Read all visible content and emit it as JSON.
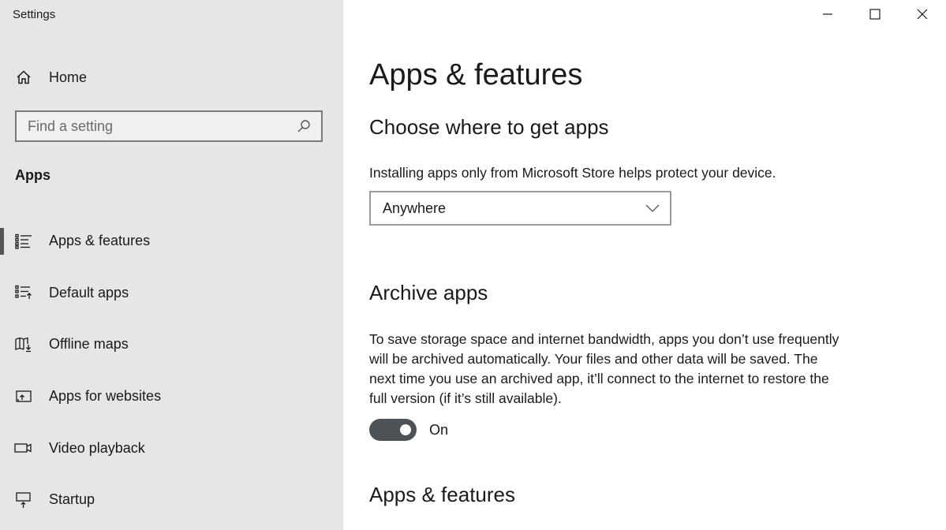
{
  "window": {
    "title": "Settings",
    "controls": {
      "minimize": "minimize-icon",
      "maximize": "maximize-icon",
      "close": "close-icon"
    }
  },
  "sidebar": {
    "home_label": "Home",
    "search": {
      "placeholder": "Find a setting",
      "value": ""
    },
    "section_label": "Apps",
    "items": [
      {
        "label": "Apps & features",
        "icon": "apps-features-icon",
        "selected": true
      },
      {
        "label": "Default apps",
        "icon": "default-apps-icon",
        "selected": false
      },
      {
        "label": "Offline maps",
        "icon": "offline-maps-icon",
        "selected": false
      },
      {
        "label": "Apps for websites",
        "icon": "apps-for-websites-icon",
        "selected": false
      },
      {
        "label": "Video playback",
        "icon": "video-playback-icon",
        "selected": false
      },
      {
        "label": "Startup",
        "icon": "startup-icon",
        "selected": false
      }
    ]
  },
  "main": {
    "title": "Apps & features",
    "choose_section": {
      "heading": "Choose where to get apps",
      "description": "Installing apps only from Microsoft Store helps protect your device.",
      "dropdown_value": "Anywhere"
    },
    "archive_section": {
      "heading": "Archive apps",
      "description": "To save storage space and internet bandwidth, apps you don’t use frequently will be archived automatically. Your files and other data will be saved. The next time you use an archived app, it’ll connect to the internet to restore the full version (if it’s still available).",
      "toggle_state": true,
      "toggle_label": "On"
    },
    "apps_features_section": {
      "heading": "Apps & features"
    }
  },
  "colors": {
    "sidebar_bg": "#e6e6e6",
    "toggle_on": "#4d5257",
    "selection_bar": "#555555"
  }
}
